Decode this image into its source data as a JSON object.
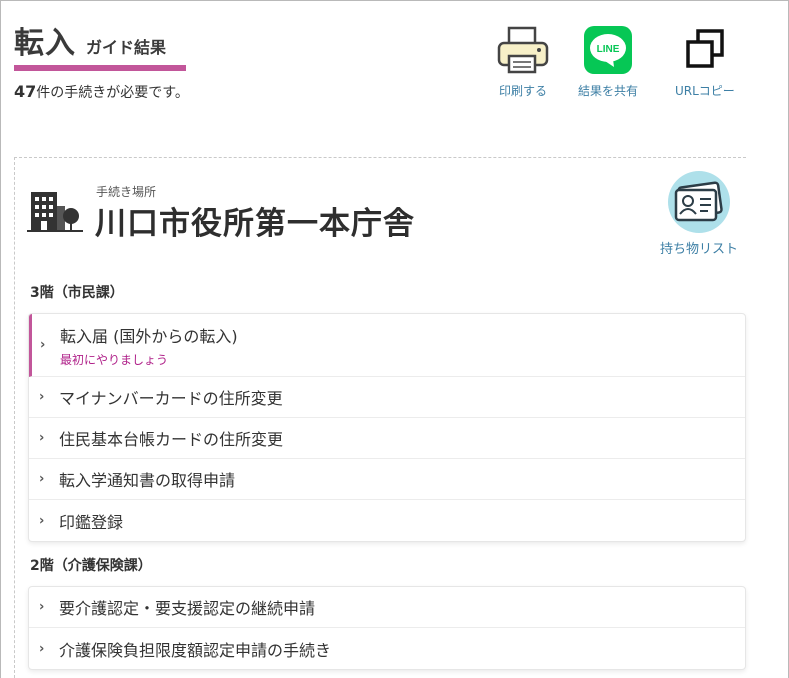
{
  "header": {
    "title": "転入",
    "subtitle": "ガイド結果",
    "count_number": "47",
    "count_suffix": "件の手続きが必要です。"
  },
  "actions": [
    {
      "label": "印刷する",
      "icon": "printer-icon"
    },
    {
      "label": "結果を共有",
      "icon": "line-icon",
      "badge": "LINE"
    },
    {
      "label": "URLコピー",
      "icon": "copy-icon"
    }
  ],
  "place": {
    "label": "手続き場所",
    "name": "川口市役所第一本庁舎",
    "belongings_label": "持ち物リスト"
  },
  "floors": [
    {
      "heading": "3階（市民課）",
      "items": [
        {
          "label": "転入届 (国外からの転入)",
          "note": "最初にやりましょう"
        },
        {
          "label": "マイナンバーカードの住所変更"
        },
        {
          "label": "住民基本台帳カードの住所変更"
        },
        {
          "label": "転入学通知書の取得申請"
        },
        {
          "label": "印鑑登録"
        }
      ]
    },
    {
      "heading": "2階（介護保険課）",
      "items": [
        {
          "label": "要介護認定・要支援認定の継続申請"
        },
        {
          "label": "介護保険負担限度額認定申請の手続き"
        }
      ]
    }
  ],
  "colors": {
    "accent": "#c2569a",
    "link": "#3d7fa5",
    "line_green": "#06c755",
    "note": "#b0228a"
  }
}
